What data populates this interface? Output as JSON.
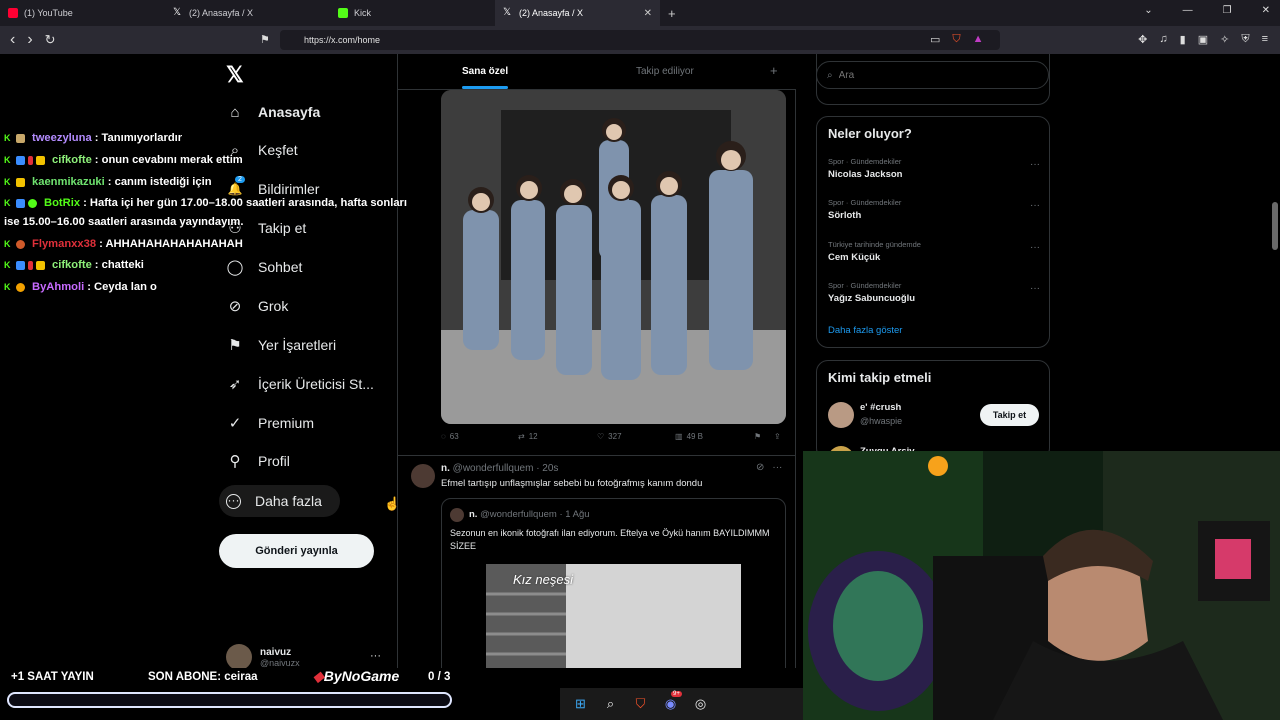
{
  "browser": {
    "tabs": [
      {
        "label": "(1) YouTube",
        "color": "#ff0033",
        "active": false
      },
      {
        "label": "(2) Anasayfa / X",
        "color": "#ffffff",
        "active": false
      },
      {
        "label": "Kick",
        "color": "#53fc18",
        "active": false
      },
      {
        "label": "(2) Anasayfa / X",
        "color": "#ffffff",
        "active": true
      }
    ],
    "tab_close": "✕",
    "new_tab": "+",
    "url": "https://x.com/home",
    "window_controls": {
      "dropdown": "⌄",
      "minimize": "—",
      "restore": "❐",
      "close": "✕"
    },
    "nav": {
      "back": "‹",
      "forward": "›",
      "reload": "↻",
      "bookmark": "⚑"
    }
  },
  "x": {
    "logo": "𝕏",
    "nav_items": [
      {
        "label": "Anasayfa",
        "icon": "home-icon",
        "glyph": "⌂"
      },
      {
        "label": "Keşfet",
        "icon": "search-icon",
        "glyph": "⌕"
      },
      {
        "label": "Bildirimler",
        "icon": "bell-icon",
        "glyph": "🔔"
      },
      {
        "label": "Takip et",
        "icon": "person-icon",
        "glyph": "👤"
      },
      {
        "label": "Sohbet",
        "icon": "chat-icon",
        "glyph": "◯"
      },
      {
        "label": "Grok",
        "icon": "grok-icon",
        "glyph": "⊘"
      },
      {
        "label": "Yer İşaretleri",
        "icon": "bookmark-icon",
        "glyph": "⚑"
      },
      {
        "label": "İçerik Üreticisi St...",
        "icon": "rocket-icon",
        "glyph": "➶"
      },
      {
        "label": "Premium",
        "icon": "verified-icon",
        "glyph": "✓"
      },
      {
        "label": "Profil",
        "icon": "profile-icon",
        "glyph": "⚲"
      },
      {
        "label": "Daha fazla",
        "icon": "more-icon",
        "glyph": "⋯"
      }
    ],
    "notification_count": "2",
    "post_button": "Gönderi yayınla",
    "account": {
      "name": "naivuz",
      "handle": "@naivuzx",
      "more": "···"
    },
    "feed_tabs": {
      "for_you": "Sana özel",
      "following": "Takip ediliyor",
      "plus": "+"
    },
    "post1_actions": {
      "replies": "63",
      "reposts": "12",
      "likes": "327",
      "views": "49 B"
    },
    "post2": {
      "name": "n.",
      "handle": "@wonderfullquem",
      "time": "· 20s",
      "text": "Efmel tartışıp unflaşmışlar sebebi bu fotoğrafmış kanım dondu",
      "quote": {
        "name": "n.",
        "handle": "@wonderfullquem",
        "time": "· 1 Ağu",
        "text": "Sezonun en ikonik fotoğrafı ilan ediyorum. Eftelya ve Öykü hanım BAYILDIMMM SİZEE",
        "image_caption": "Kız neşesi"
      }
    },
    "search": {
      "placeholder": "Ara"
    },
    "whats_happening": {
      "title": "Neler oluyor?",
      "trends": [
        {
          "context": "Spor · Gündemdekiler",
          "name": "Nicolas Jackson"
        },
        {
          "context": "Spor · Gündemdekiler",
          "name": "Sörloth"
        },
        {
          "context": "Türkiye tarihinde gündemde",
          "name": "Cem Küçük"
        },
        {
          "context": "Spor · Gündemdekiler",
          "name": "Yağız Sabuncuoğlu"
        }
      ],
      "show_more": "Daha fazla göster",
      "dots": "···"
    },
    "who_to_follow": {
      "title": "Kimi takip etmeli",
      "users": [
        {
          "name": "e' #crush",
          "handle": "@hwaspie",
          "button": "Takip et"
        },
        {
          "name": "Zuygu Arsiv",
          "handle": "",
          "button": ""
        }
      ]
    }
  },
  "chat": [
    {
      "user": "tweezyluna",
      "color": "#b48cff",
      "message": ": Tanımıyorlardır"
    },
    {
      "user": "cifkofte",
      "color": "#8ef07a",
      "message": ": onun cevabını merak ettim"
    },
    {
      "user": "kaenmikazuki",
      "color": "#6fe36f",
      "message": ": canım istediği için"
    },
    {
      "user": "BotRix",
      "color": "#53fc18",
      "message": ": Hafta içi her gün 17.00–18.00 saatleri arasında, hafta sonları"
    },
    {
      "user": "",
      "color": "#ffffff",
      "message": "ise 15.00–16.00 saatleri arasında yayındayım."
    },
    {
      "user": "Flymanxx38",
      "color": "#e0303a",
      "message": ": AHHAHAHAHAHAHAHAH"
    },
    {
      "user": "cifkofte",
      "color": "#8ef07a",
      "message": ": chatteki"
    },
    {
      "user": "ByAhmoli",
      "color": "#c86bff",
      "message": ": Ceyda lan o"
    }
  ],
  "stream_overlay": {
    "extra_hour": "+1 SAAT YAYIN",
    "last_sub": "SON ABONE: ceiraa",
    "brand": "ByNoGame",
    "counter": "0 / 3"
  },
  "taskbar": {
    "discord_badge": "9+"
  }
}
